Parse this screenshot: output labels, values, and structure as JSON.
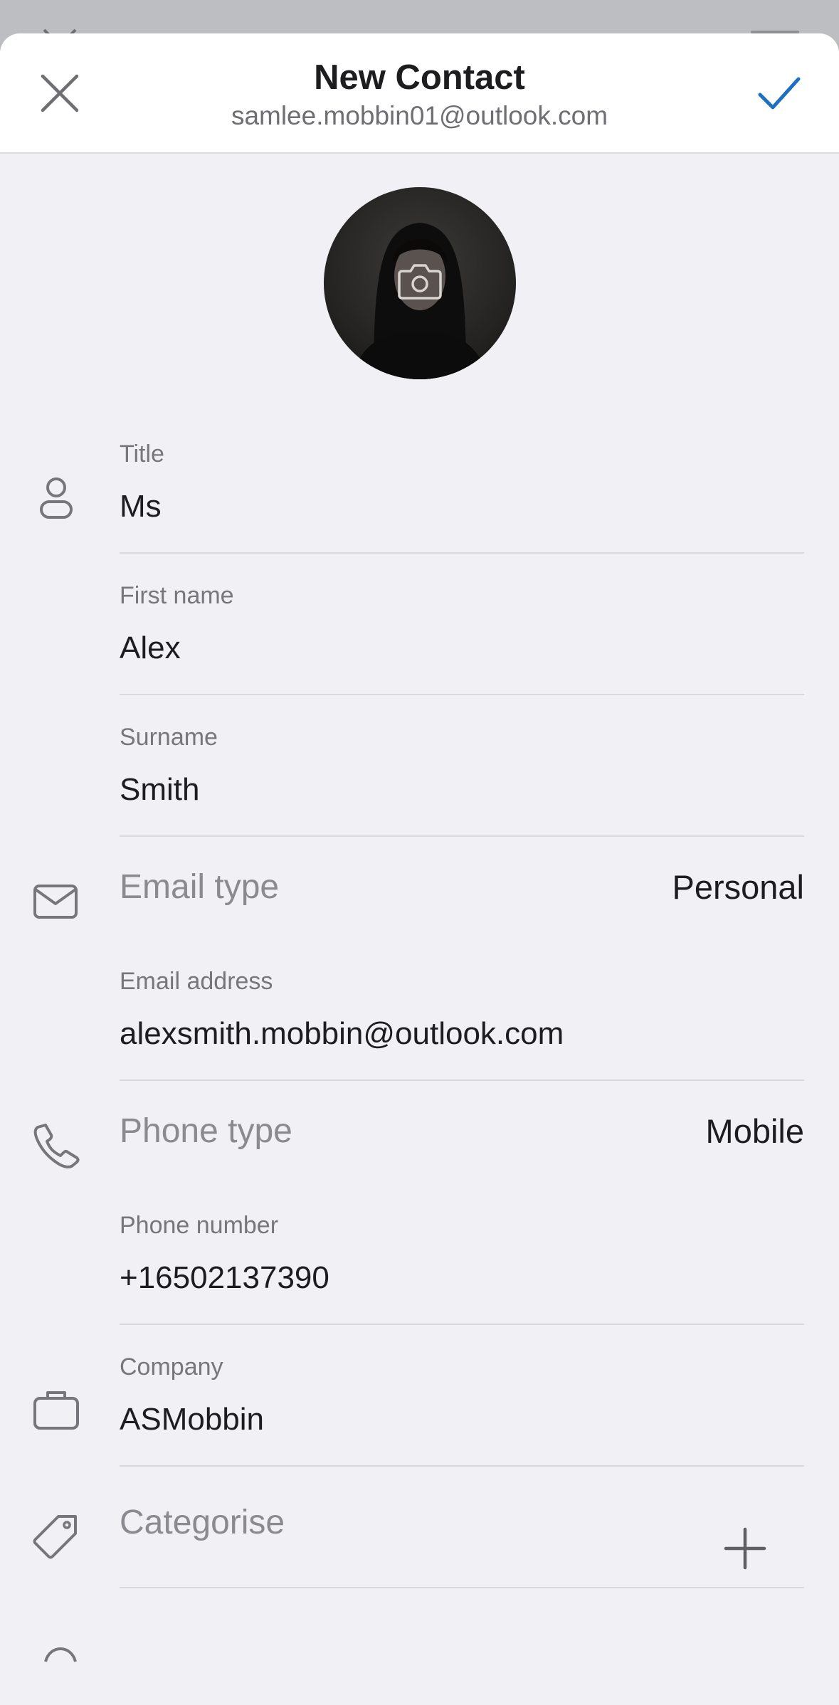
{
  "header": {
    "title": "New Contact",
    "account": "samlee.mobbin01@outlook.com"
  },
  "icons": {
    "close": "close-icon",
    "confirm": "checkmark-icon",
    "camera": "camera-icon",
    "person": "person-icon",
    "mail": "mail-icon",
    "phone": "phone-icon",
    "briefcase": "briefcase-icon",
    "tag": "tag-icon",
    "plus": "plus-icon"
  },
  "fields": {
    "title": {
      "label": "Title",
      "value": "Ms"
    },
    "first_name": {
      "label": "First name",
      "value": "Alex"
    },
    "surname": {
      "label": "Surname",
      "value": "Smith"
    },
    "email_type": {
      "label": "Email type",
      "value": "Personal"
    },
    "email_address": {
      "label": "Email address",
      "value": "alexsmith.mobbin@outlook.com"
    },
    "phone_type": {
      "label": "Phone type",
      "value": "Mobile"
    },
    "phone_number": {
      "label": "Phone number",
      "value": "+16502137390"
    },
    "company": {
      "label": "Company",
      "value": "ASMobbin"
    },
    "categorise": {
      "label": "Categorise"
    }
  },
  "colors": {
    "accent": "#1d6fc4",
    "background": "#f0f0f5",
    "header_background": "#ffffff",
    "divider": "#d8d8dd"
  }
}
